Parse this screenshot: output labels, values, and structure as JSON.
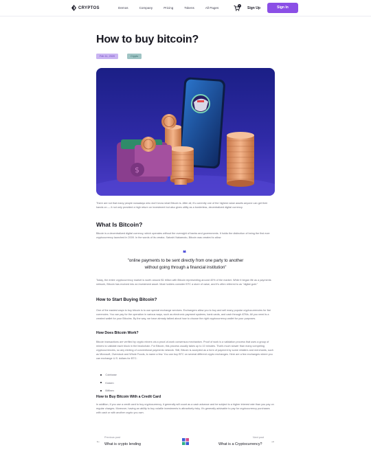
{
  "nav": {
    "logo": "CRYPTOS",
    "menu": [
      "Demos",
      "Company",
      "Pricing",
      "Tokens",
      "All Pages"
    ],
    "cart_count": "0",
    "signup": "Sign Up",
    "signin": "Sign In"
  },
  "article": {
    "title": "How to buy bitcoin?",
    "date": "Feb 11, 2020",
    "tag": "Crypto",
    "intro": "There are not that many people nowadays who don't know what Bitcoin is. After all, it's currently one of the highest value assets anyone can get their hands on — it not only provided a high return on investment but also gives utility as a borderless, decentralized digital currency.",
    "h_what": "What Is Bitcoin?",
    "p_what": "Bitcoin is a decentralized digital currency, which operates without the oversight of banks and governments. It holds the distinction of being the first ever cryptocurrency launched in 2009. In the words of its creator, Satoshi Nakamoto, Bitcoin was created to allow",
    "quote": "\"online payments to be sent directly from one party to another without going through a financial institution\"",
    "p_after_quote": "Today, the entire cryptocurrency market is worth around $1 trillion with Bitcoin representing around 40% of the market. While it began life as a payments network, Bitcoin has evolved into an investment asset. Most holders consider BTC a store of value, and it's often referred to as \"digital gold.\"",
    "h_start": "How to Start Buying Bitcoin?",
    "p_start": "One of the easiest ways to buy bitcoin is to use special exchange services. Exchangers allow you to buy and sell many popular cryptocurrencies for fiat currencies. You can pay for the operation in various ways, such as electronic payment systems, bank cards, and cash through ATMs. All you need is a created wallet for your Bitcoins. By the way, we have already talked about how to choose the right cryptocurrency wallet for your purposes.",
    "h_work": "How Does Bitcoin Work?",
    "p_work": "Bitcoin transactions are verified by crypto miners via a proof-of-work consensus mechanism. Proof of work is a validation process that uses a group of miners to validate each block in the blockchain. For Bitcoin, this process usually takes up to 10 minutes. That's much slower than many competing cryptocurrencies, so any minting of conventional payments network. Still, Bitcoin is accepted as a form of payment by some retailers and merchants, such as Microsoft, Overstock and Whole Foods, to name a few. You can buy BTC on several different crypto exchanges. Here are a few exchanges where you can exchange U.S. dollars for BTC:",
    "exchanges": [
      "Coinbase",
      "Kraken",
      "Bitfinex"
    ],
    "h_card": "How to Buy Bitcoin With a Credit Card",
    "p_card": "In addition, if you use a credit card to buy cryptocurrency, it generally will count as a cash advance and be subject to a higher interest rate than you pay on regular charges. Moreover, having an ability to buy volatile investments is attractively risky. It's generally advisable to pay for cryptocurrency purchases with cash or with another crypto you own."
  },
  "pagination": {
    "prev_label": "Previous post",
    "prev_title": "What is crypto lending",
    "next_label": "Next post",
    "next_title": "What is a Cryptocurrency?"
  },
  "colors": {
    "accent": "#8b4fe6",
    "date_badge": "#c9b4f2",
    "tag_badge": "#9fc4c4",
    "quote_mark": "#3b3bd6"
  }
}
